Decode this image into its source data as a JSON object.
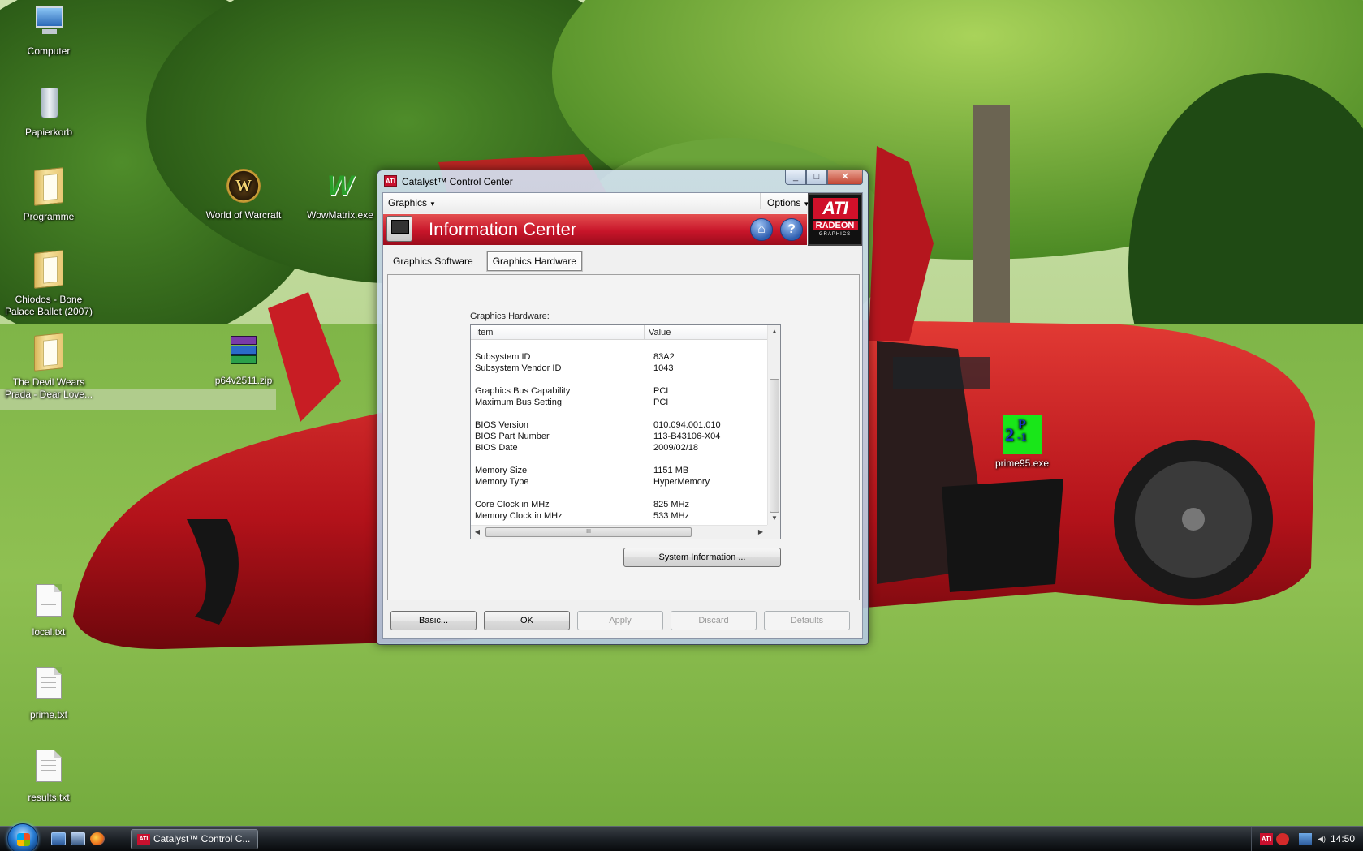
{
  "desktop": {
    "icons": [
      {
        "label": "Computer"
      },
      {
        "label": "Papierkorb"
      },
      {
        "label": "Programme"
      },
      {
        "label": "Chiodos - Bone Palace Ballet (2007)"
      },
      {
        "label": "The Devil Wears Prada - Dear Love..."
      },
      {
        "label": "World of Warcraft"
      },
      {
        "label": "WowMatrix.exe"
      },
      {
        "label": "p64v2511.zip"
      },
      {
        "label": "local.txt"
      },
      {
        "label": "prime.txt"
      },
      {
        "label": "results.txt"
      },
      {
        "label": "prime95.exe"
      }
    ]
  },
  "window": {
    "title": "Catalyst™ Control Center",
    "app_icon_text": "ATI",
    "controls": {
      "minimize": "_",
      "maximize": "□",
      "close": "✕"
    },
    "menus": {
      "graphics": "Graphics",
      "options": "Options"
    },
    "logo": {
      "brand": "ATI",
      "line1": "RADEON",
      "line2": "GRAPHICS"
    },
    "header": {
      "title": "Information Center",
      "home_glyph": "⌂",
      "help_glyph": "?"
    },
    "tabs": [
      {
        "label": "Graphics Software",
        "active": false
      },
      {
        "label": "Graphics Hardware",
        "active": true
      }
    ],
    "section_label": "Graphics Hardware:",
    "table": {
      "columns": [
        "Item",
        "Value"
      ],
      "rows": [
        {
          "item": "Subsystem ID",
          "value": "83A2"
        },
        {
          "item": "Subsystem Vendor ID",
          "value": "1043"
        },
        {
          "item": "Graphics Bus Capability",
          "value": "PCI"
        },
        {
          "item": "Maximum Bus Setting",
          "value": "PCI"
        },
        {
          "item": "BIOS Version",
          "value": "010.094.001.010"
        },
        {
          "item": "BIOS Part Number",
          "value": "113-B43106-X04"
        },
        {
          "item": "BIOS Date",
          "value": "2009/02/18"
        },
        {
          "item": "Memory Size",
          "value": "1151 MB"
        },
        {
          "item": "Memory Type",
          "value": "HyperMemory"
        },
        {
          "item": "Core Clock in MHz",
          "value": "825 MHz"
        },
        {
          "item": "Memory Clock in MHz",
          "value": "533 MHz"
        }
      ],
      "hscroll_grip": "III"
    },
    "system_info_button": "System Information ...",
    "footer_buttons": [
      {
        "label": "Basic...",
        "enabled": true
      },
      {
        "label": "OK",
        "enabled": true
      },
      {
        "label": "Apply",
        "enabled": false
      },
      {
        "label": "Discard",
        "enabled": false
      },
      {
        "label": "Defaults",
        "enabled": false
      }
    ]
  },
  "taskbar": {
    "task_button": "Catalyst™ Control C...",
    "tray_ati": "ATI",
    "clock": "14:50"
  },
  "colors": {
    "ati_red": "#c8102e",
    "header_red": "#c8152a",
    "taskbar": "#1c2126"
  }
}
